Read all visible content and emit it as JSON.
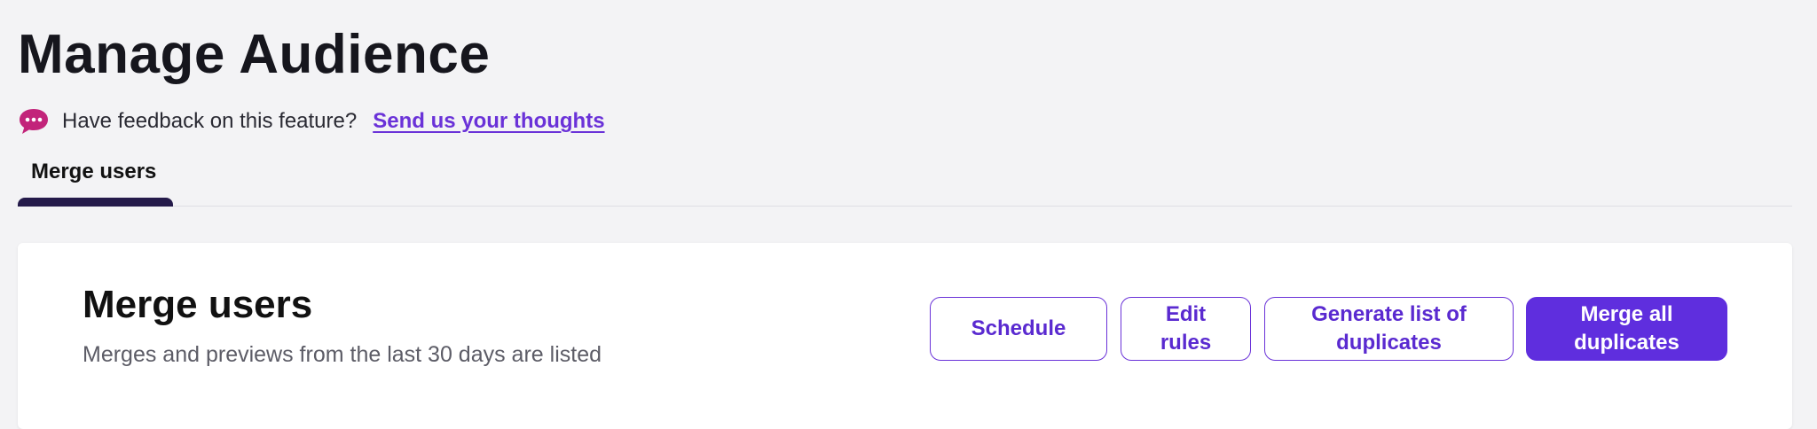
{
  "page": {
    "title": "Manage Audience"
  },
  "feedback": {
    "icon": "speech-bubble-icon",
    "prompt": "Have feedback on this feature?",
    "link_label": "Send us your thoughts"
  },
  "tabs": [
    {
      "label": "Merge users",
      "active": true
    }
  ],
  "card": {
    "title": "Merge users",
    "subtitle": "Merges and previews from the last 30 days are listed",
    "actions": {
      "schedule": "Schedule",
      "edit_rules": "Edit rules",
      "generate_list": "Generate list of duplicates",
      "merge_all": "Merge all duplicates"
    }
  },
  "colors": {
    "accent": "#6a32d8",
    "primary_button": "#5f2ede",
    "tab_indicator": "#241a4a",
    "feedback_icon": "#c2247a",
    "background": "#f3f3f5"
  }
}
